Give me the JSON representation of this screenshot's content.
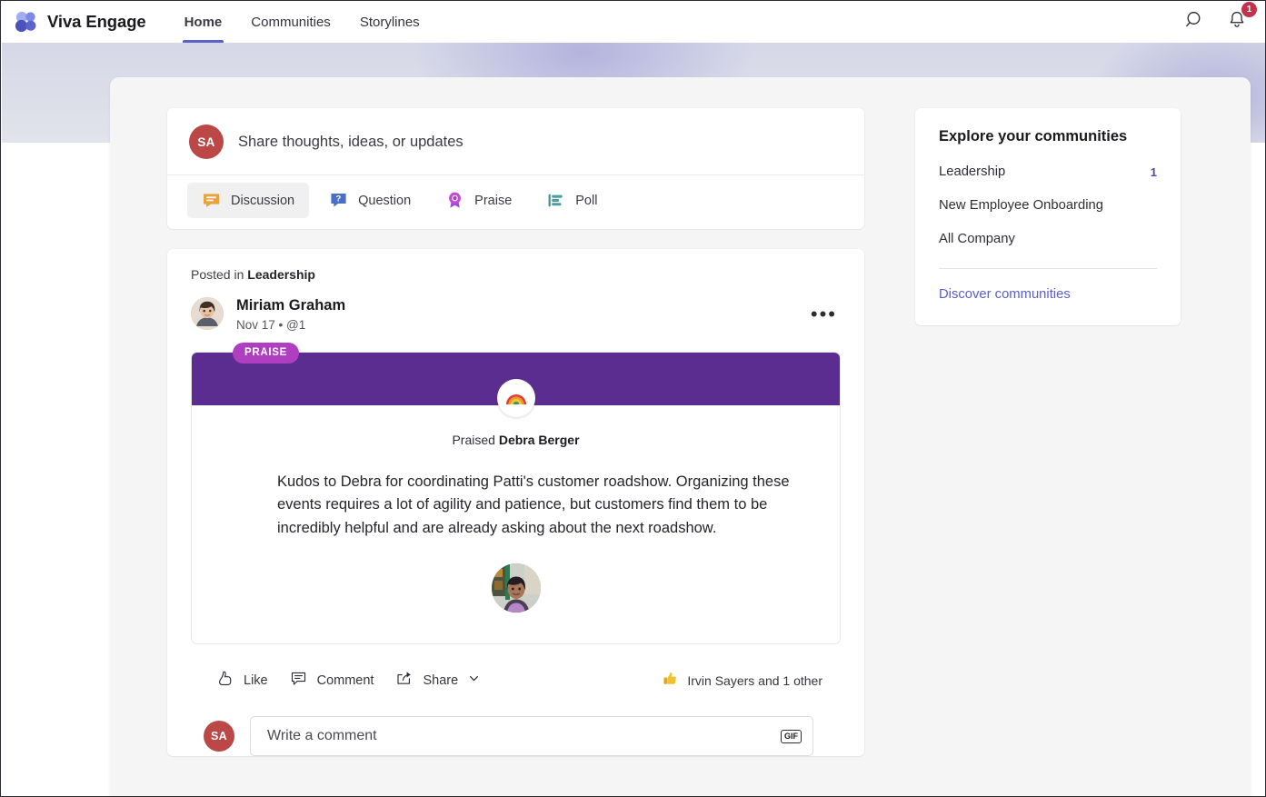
{
  "app": {
    "brand": "Viva Engage",
    "logo_icon": "viva-engage-logo"
  },
  "topnav": {
    "tabs": [
      {
        "label": "Home",
        "active": true
      },
      {
        "label": "Communities",
        "active": false
      },
      {
        "label": "Storylines",
        "active": false
      }
    ],
    "search_icon": "search-icon",
    "notifications_icon": "bell-icon",
    "notifications_badge": "1"
  },
  "composer": {
    "avatar_initials": "SA",
    "placeholder": "Share thoughts, ideas, or updates",
    "types": [
      {
        "label": "Discussion",
        "icon": "discussion-icon",
        "selected": true
      },
      {
        "label": "Question",
        "icon": "question-icon",
        "selected": false
      },
      {
        "label": "Praise",
        "icon": "praise-ribbon-icon",
        "selected": false
      },
      {
        "label": "Poll",
        "icon": "poll-icon",
        "selected": false
      }
    ]
  },
  "post": {
    "posted_in_prefix": "Posted in",
    "community": "Leadership",
    "author": "Miriam Graham",
    "date": "Nov 17",
    "separator": "•",
    "mentions": "@1",
    "more_icon": "more-options-icon",
    "praise": {
      "badge": "PRAISE",
      "emoji": "rainbow-icon",
      "praised_prefix": "Praised",
      "praised_name": "Debra Berger",
      "text": "Kudos to Debra for coordinating Patti's customer roadshow. Organizing these events requires a lot of agility and patience, but customers find them to be incredibly helpful and are already asking about the next roadshow.",
      "photo_alt": "praised-person-photo"
    },
    "actions": [
      {
        "label": "Like",
        "icon": "like-icon"
      },
      {
        "label": "Comment",
        "icon": "comment-icon"
      },
      {
        "label": "Share",
        "icon": "share-icon"
      }
    ],
    "share_chevron": "chevron-down-icon",
    "reactions": {
      "icon": "thumbs-up-icon",
      "text": "Irvin Sayers and 1 other"
    },
    "comment_box": {
      "avatar_initials": "SA",
      "placeholder": "Write a comment",
      "gif_label": "GIF"
    }
  },
  "rail": {
    "title": "Explore your communities",
    "items": [
      {
        "label": "Leadership",
        "count": "1"
      },
      {
        "label": "New Employee Onboarding",
        "count": ""
      },
      {
        "label": "All Company",
        "count": ""
      }
    ],
    "discover_link": "Discover communities"
  },
  "colors": {
    "accent": "#5b5fc7",
    "praise_purple": "#5c2d91",
    "praise_pill": "#af3ec1",
    "avatar_red": "#bb4747",
    "badge_red": "#c4314b",
    "link": "#5b5fc7"
  }
}
